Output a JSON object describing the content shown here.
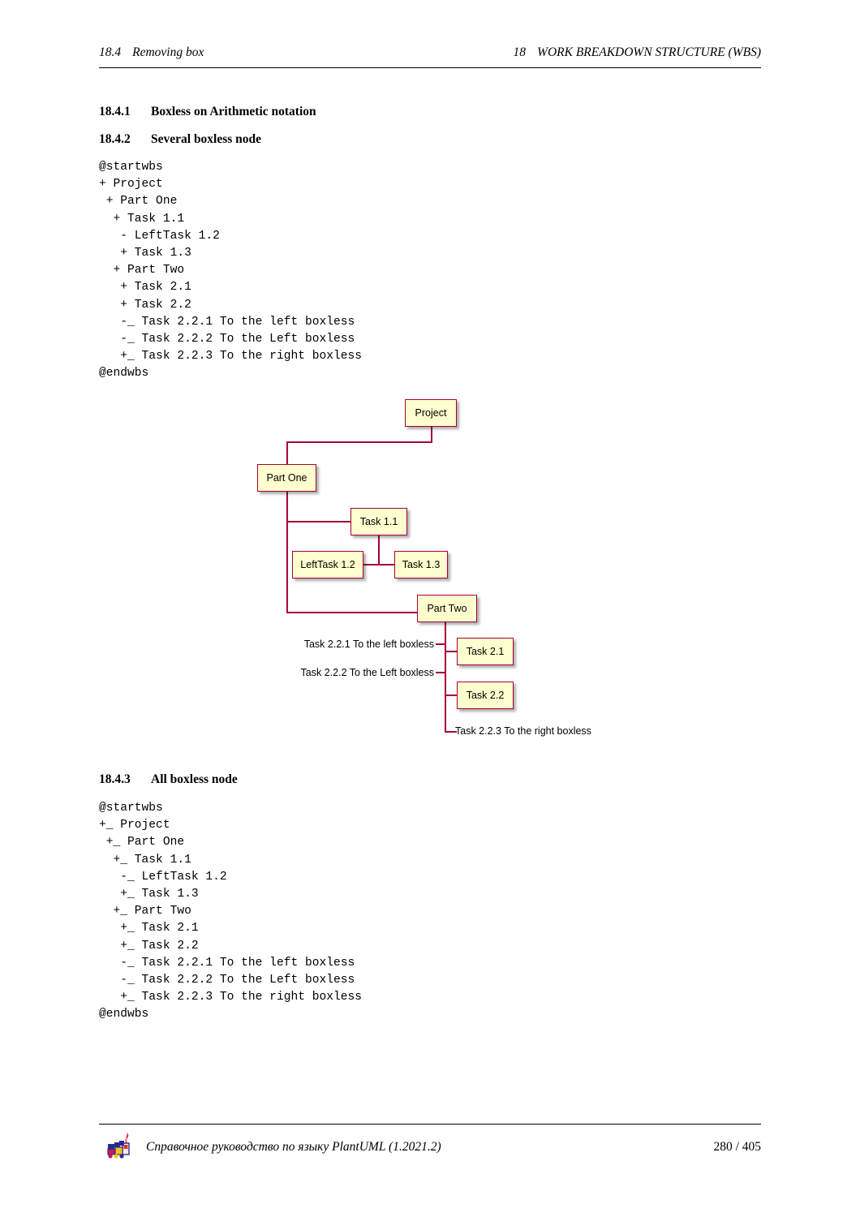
{
  "header": {
    "left_number": "18.4",
    "left_title": "Removing box",
    "right_number": "18",
    "right_title": "WORK BREAKDOWN STRUCTURE (WBS)"
  },
  "sections": [
    {
      "number": "18.4.1",
      "title": "Boxless on Arithmetic notation"
    },
    {
      "number": "18.4.2",
      "title": "Several boxless node"
    },
    {
      "number": "18.4.3",
      "title": "All boxless node"
    }
  ],
  "code_blocks": {
    "several_boxless": "@startwbs\n+ Project\n + Part One\n  + Task 1.1\n   - LeftTask 1.2\n   + Task 1.3\n  + Part Two\n   + Task 2.1\n   + Task 2.2\n   -_ Task 2.2.1 To the left boxless\n   -_ Task 2.2.2 To the Left boxless\n   +_ Task 2.2.3 To the right boxless\n@endwbs",
    "all_boxless": "@startwbs\n+_ Project\n +_ Part One\n  +_ Task 1.1\n   -_ LeftTask 1.2\n   +_ Task 1.3\n  +_ Part Two\n   +_ Task 2.1\n   +_ Task 2.2\n   -_ Task 2.2.1 To the left boxless\n   -_ Task 2.2.2 To the Left boxless\n   +_ Task 2.2.3 To the right boxless\n@endwbs"
  },
  "diagram": {
    "boxes": {
      "project": "Project",
      "part_one": "Part One",
      "task_1_1": "Task 1.1",
      "left_task_1_2": "LeftTask 1.2",
      "task_1_3": "Task 1.3",
      "part_two": "Part Two",
      "task_2_1": "Task 2.1",
      "task_2_2": "Task 2.2"
    },
    "boxless": {
      "task_2_2_1": "Task 2.2.1 To the left boxless",
      "task_2_2_2": "Task 2.2.2 To the Left boxless",
      "task_2_2_3": "Task 2.2.3 To the right boxless"
    },
    "colors": {
      "box_fill": "#FEFECE",
      "box_border": "#A80036",
      "link": "#A80036"
    }
  },
  "footer": {
    "title": "Справочное руководство по языку PlantUML (1.2021.2)",
    "page": "280 / 405"
  }
}
